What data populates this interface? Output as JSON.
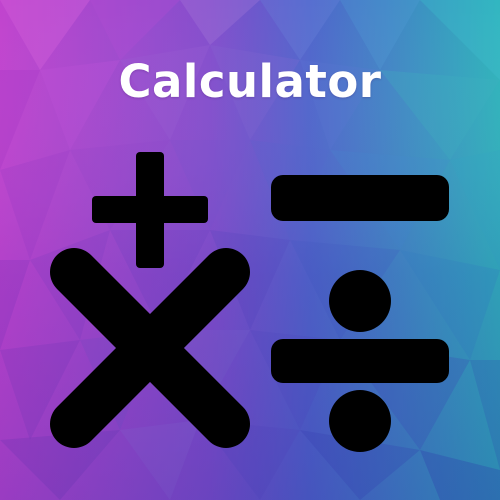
{
  "app": {
    "title": "Calculator"
  },
  "colors": {
    "title_text": "#ffffff",
    "symbols": "#000000",
    "bg_magenta": "#d44fd8",
    "bg_purple": "#7a46c4",
    "bg_blue": "#3f49b8",
    "bg_teal": "#35b6b6"
  },
  "icons": {
    "plus": "plus-icon",
    "minus": "minus-icon",
    "multiply": "multiply-icon",
    "divide": "divide-icon"
  }
}
